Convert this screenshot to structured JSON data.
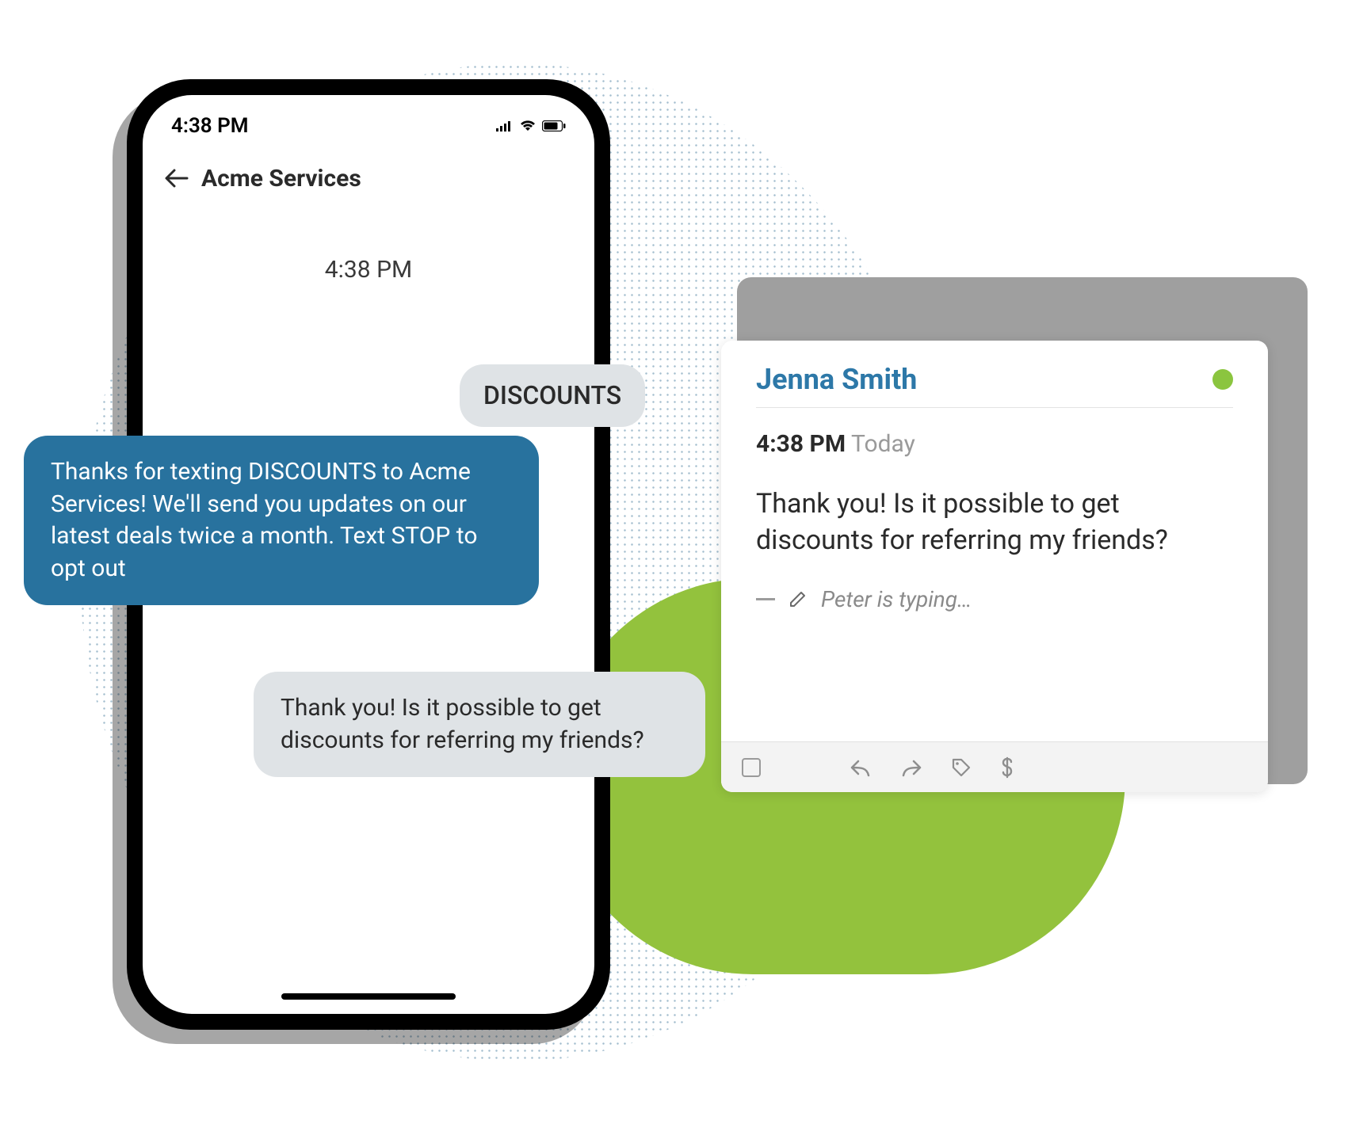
{
  "phone": {
    "status_time": "4:38 PM",
    "nav_title": "Acme Services",
    "thread_timestamp": "4:38 PM"
  },
  "bubbles": {
    "discounts": "DISCOUNTS",
    "auto_reply": "Thanks for texting DISCOUNTS to Acme Services! We'll send you updates on our latest deals twice a month. Text STOP to opt out",
    "user_msg": "Thank you! Is it possible to get discounts for referring my friends?"
  },
  "card": {
    "contact_name": "Jenna Smith",
    "time": "4:38 PM",
    "day": "Today",
    "message": "Thank you! Is it possible to get discounts for referring my friends?",
    "typing": "Peter is typing…"
  },
  "icons": {
    "back": "back-arrow-icon",
    "signal": "cellular-signal-icon",
    "wifi": "wifi-icon",
    "battery": "battery-icon",
    "status_dot": "online-status-icon",
    "pencil": "pencil-icon",
    "checkbox": "checkbox-icon",
    "reply": "reply-arrow-icon",
    "forward": "forward-arrow-icon",
    "tag": "tag-icon",
    "dollar": "dollar-icon"
  }
}
